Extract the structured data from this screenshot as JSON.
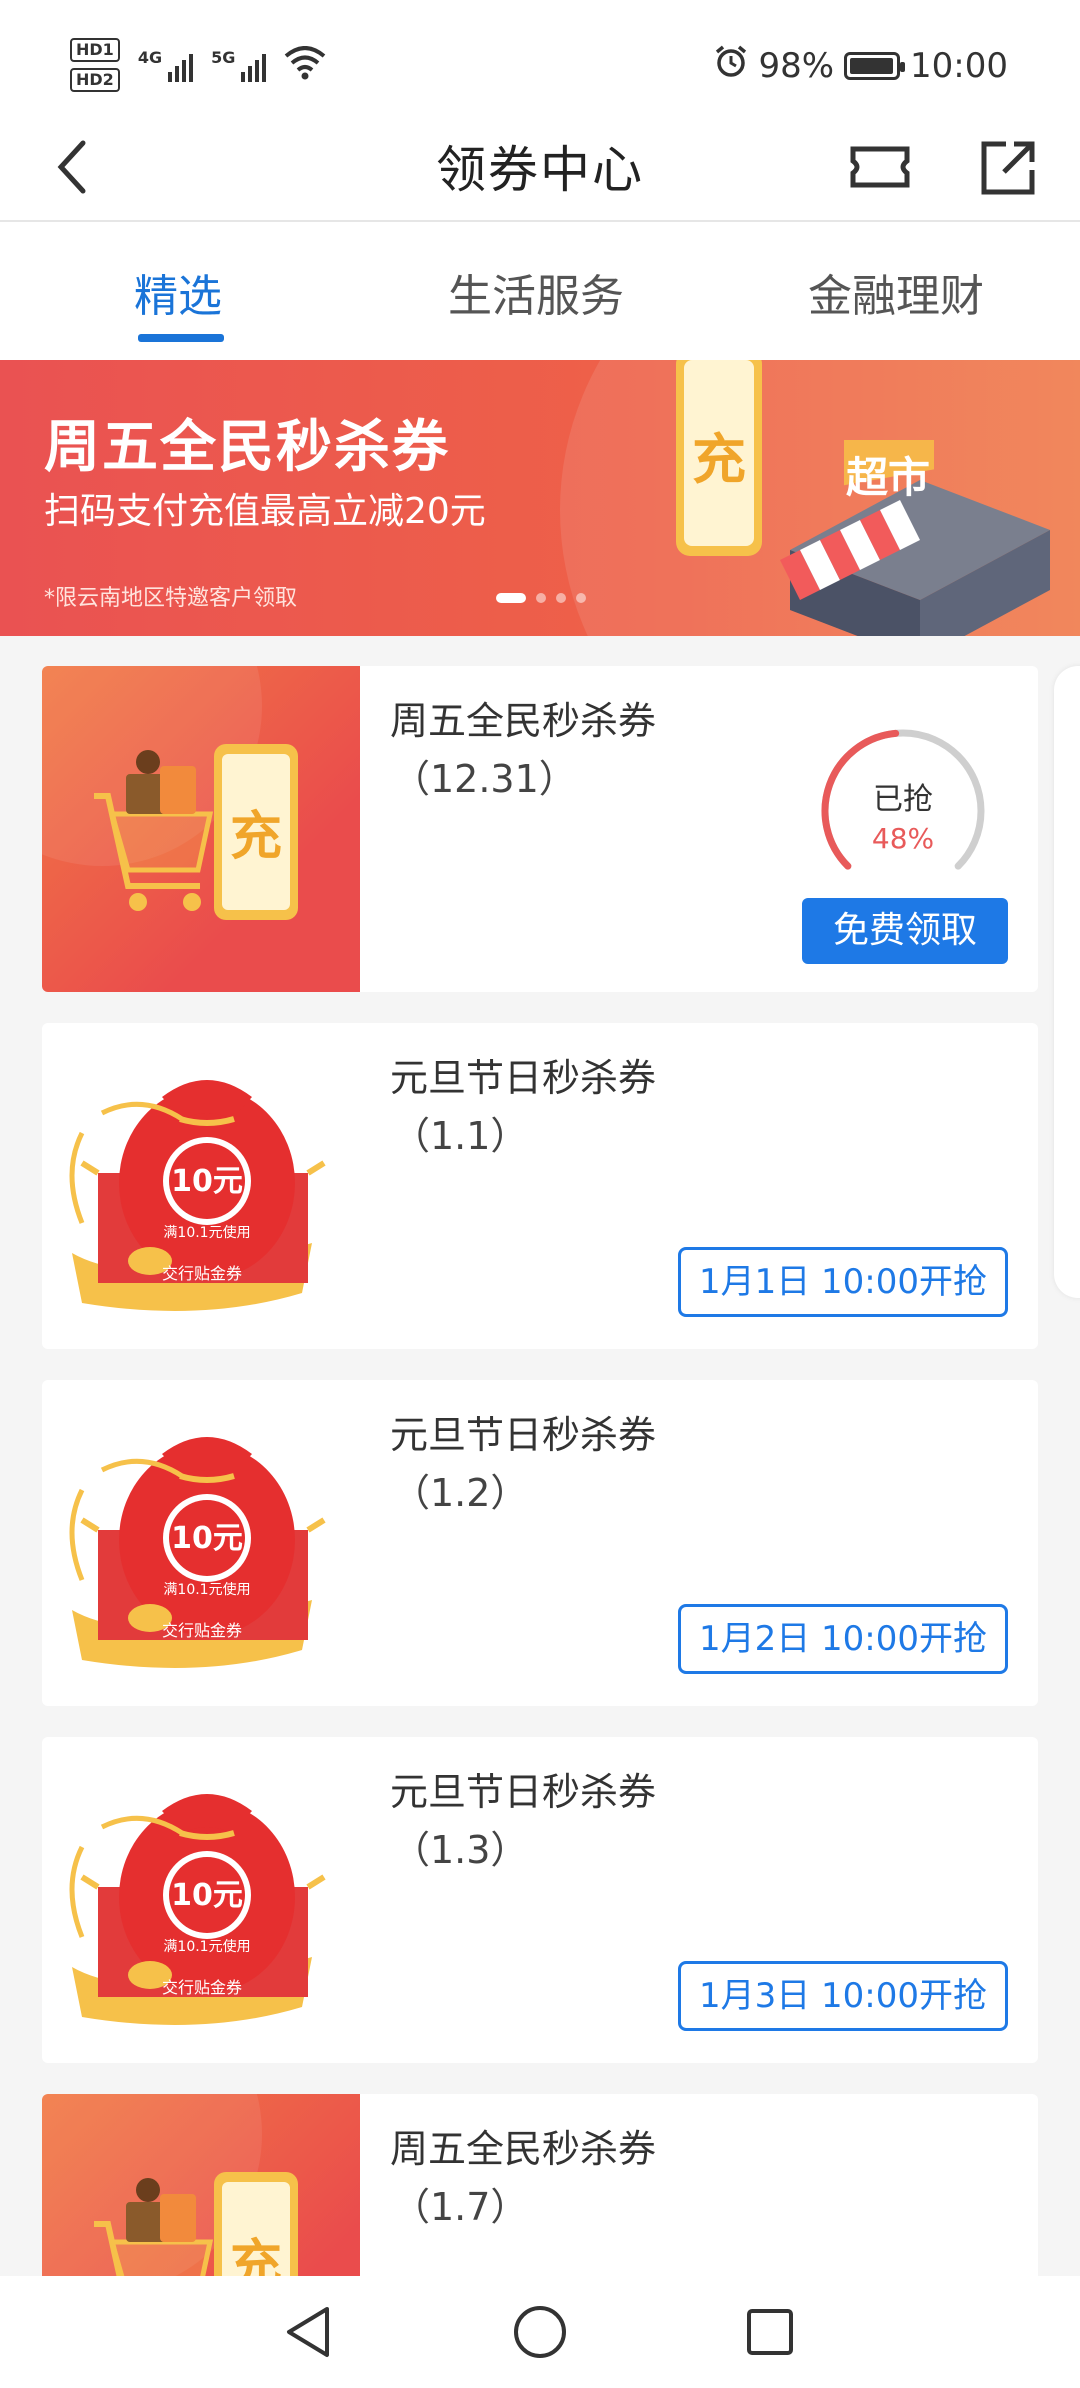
{
  "status_bar": {
    "hd1": "HD1",
    "hd2": "HD2",
    "net1": "4G",
    "net2": "5G",
    "battery_level": "98%",
    "time": "10:00",
    "battery_fill": 0.98
  },
  "header": {
    "title": "领券中心",
    "back_icon": "chevron-left-icon",
    "coupon_icon": "coupon-ticket-icon",
    "share_icon": "share-export-icon"
  },
  "tabs": [
    {
      "label": "精选",
      "active": true
    },
    {
      "label": "生活服务",
      "active": false
    },
    {
      "label": "金融理财",
      "active": false
    }
  ],
  "banner": {
    "title": "周五全民秒杀券",
    "subtitle": "扫码支付充值最高立减20元",
    "note": "*限云南地区特邀客户领取",
    "phone_char": "充",
    "store_sign": "超市",
    "slide_count": 4,
    "active_slide": 1
  },
  "coupons": [
    {
      "title": "周五全民秒杀券",
      "subtitle": "（12.31）",
      "image": "cart-phone-recharge",
      "image_char": "充",
      "progress_label": "已抢",
      "progress_value": "48%",
      "progress": 0.48,
      "action": "免费领取"
    },
    {
      "title": "元旦节日秒杀券",
      "subtitle": "（1.1）",
      "image": "red-lucky-bag",
      "bag_value": "10元",
      "bag_condition": "满10.1元使用",
      "bag_label": "交行贴金券",
      "action": "1月1日 10:00开抢"
    },
    {
      "title": "元旦节日秒杀券",
      "subtitle": "（1.2）",
      "image": "red-lucky-bag",
      "bag_value": "10元",
      "bag_condition": "满10.1元使用",
      "bag_label": "交行贴金券",
      "action": "1月2日 10:00开抢"
    },
    {
      "title": "元旦节日秒杀券",
      "subtitle": "（1.3）",
      "image": "red-lucky-bag",
      "bag_value": "10元",
      "bag_condition": "满10.1元使用",
      "bag_label": "交行贴金券",
      "action": "1月3日 10:00开抢"
    },
    {
      "title": "周五全民秒杀券",
      "subtitle": "（1.7）",
      "image": "cart-phone-recharge",
      "image_char": "充"
    }
  ],
  "colors": {
    "accent": "#1e79e6",
    "tab_active": "#1a74d8",
    "banner_red": "#ea5252",
    "progress_red": "#e85a5a"
  },
  "nav_bar": {
    "back": "triangle-back-icon",
    "home": "circle-home-icon",
    "recent": "square-recents-icon"
  }
}
